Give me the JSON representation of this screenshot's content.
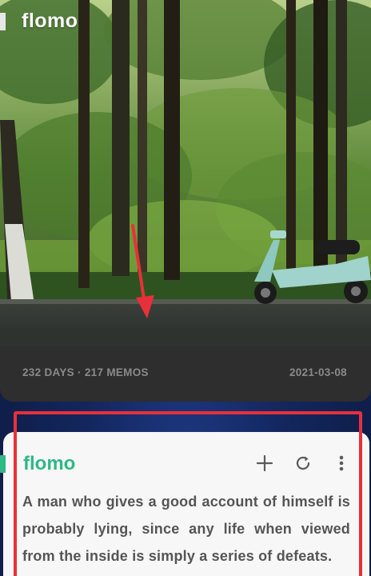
{
  "top_widget": {
    "brand": "flomo",
    "stats": "232 DAYS · 217 MEMOS",
    "date": "2021-03-08"
  },
  "memo_widget": {
    "brand": "flomo",
    "quote": "A man who gives a good account of himself is probably lying, since any life when viewed from the inside is simply a series of defeats.",
    "actions": {
      "add_icon": "plus-icon",
      "refresh_icon": "refresh-icon",
      "menu_icon": "more-vertical-icon"
    }
  },
  "colors": {
    "brand_green": "#2fb986",
    "annotation_red": "#e8303a",
    "card_dark": "#2e2e2e",
    "card_light": "#f7f7f7"
  }
}
